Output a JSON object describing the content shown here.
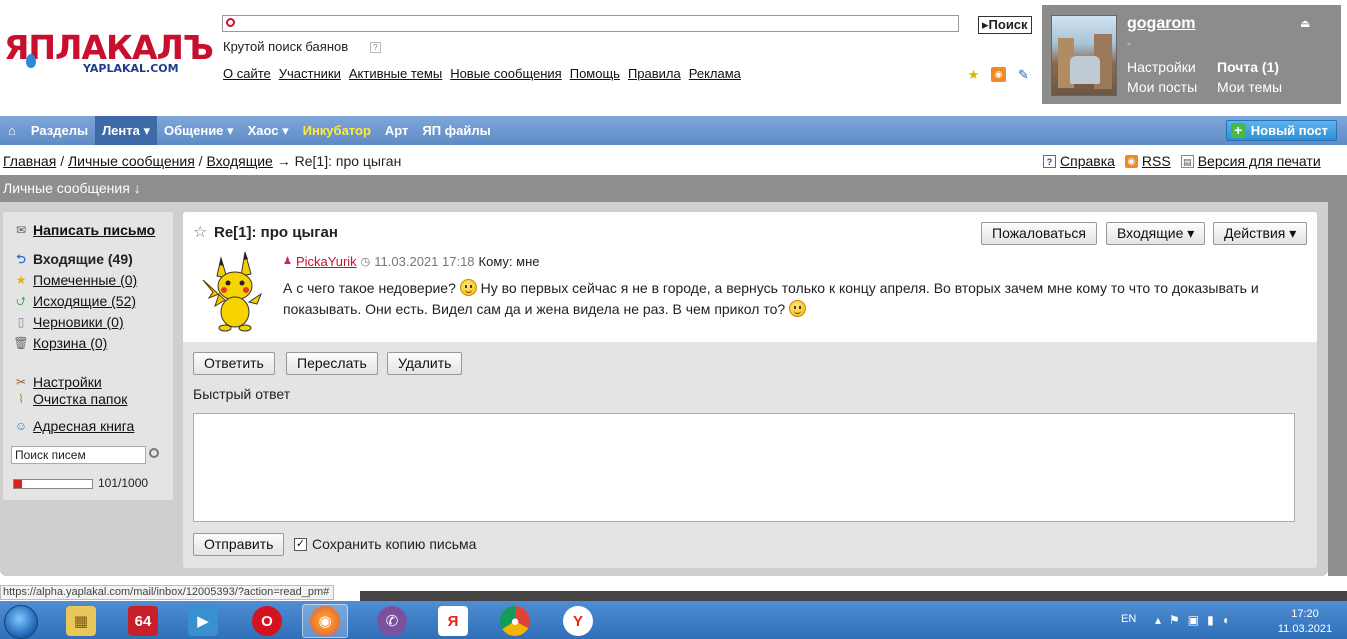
{
  "header": {
    "logo_text": "ЯПЛАКАЛЪ",
    "logo_sub": "YAPLAKAL.COM",
    "search_placeholder": "",
    "search_button": "Поиск",
    "cool_search": "Крутой поиск баянов",
    "nav": [
      "О сайте",
      "Участники",
      "Активные темы",
      "Новые сообщения",
      "Помощь",
      "Правила",
      "Реклама"
    ]
  },
  "user": {
    "name": "gogarom",
    "dash": "-",
    "settings": "Настройки",
    "mail": "Почта (1)",
    "my_posts": "Мои посты",
    "my_themes": "Мои темы"
  },
  "mainnav": {
    "items": [
      "Разделы",
      "Лента ▾",
      "Общение ▾",
      "Хаос ▾",
      "Инкубатор",
      "Арт",
      "ЯП файлы"
    ],
    "new_post": "Новый пост"
  },
  "breadcrumb": {
    "home": "Главная",
    "pm": "Личные сообщения",
    "inbox": "Входящие",
    "arrow": "→",
    "current": "Re[1]: про цыган"
  },
  "tools": {
    "help": "Справка",
    "rss": "RSS",
    "print": "Версия для печати"
  },
  "section_title": "Личные сообщения ↓",
  "sidebar": {
    "compose": "Написать письмо",
    "inbox": "Входящие (49)",
    "marked": "Помеченные (0)",
    "outbox": "Исходящие (52)",
    "drafts": "Черновики (0)",
    "trash": "Корзина (0)",
    "settings": "Настройки",
    "clean": "Очистка папок",
    "address_book": "Адресная книга",
    "search_value": "Поиск писем",
    "quota_text": "101/1000",
    "quota_fraction": 0.101
  },
  "message": {
    "title": "Re[1]: про цыган",
    "complain": "Пожаловаться",
    "inbox_dropdown": "Входящие ▾",
    "actions_dropdown": "Действия ▾",
    "author": "PickaYurik",
    "date": "11.03.2021 17:18",
    "to": "Кому: мне",
    "body_part1": "А с чего такое недоверие?",
    "body_part2": "Ну во первых сейчас я не в городе, а вернусь только к концу апреля. Во вторых зачем мне кому то что то доказывать и показывать. Они есть. Видел сам да и жена видела не раз. В чем прикол то?",
    "reply": "Ответить",
    "forward": "Переслать",
    "delete": "Удалить",
    "quick_reply": "Быстрый ответ",
    "send": "Отправить",
    "save_copy": "Сохранить копию письма"
  },
  "status_url": "https://alpha.yaplakal.com/mail/inbox/12005393/?action=read_pm#",
  "taskbar": {
    "apps": [
      "explorer",
      "64",
      "media",
      "opera",
      "firefox",
      "viber",
      "yandex",
      "chrome",
      "yandex-browser"
    ],
    "lang": "EN",
    "time": "17:20",
    "date": "11.03.2021"
  },
  "colors": {
    "nav_blue": "#5f8cc6",
    "logo_red": "#c8102e",
    "user_gray": "#8c8c8c"
  }
}
